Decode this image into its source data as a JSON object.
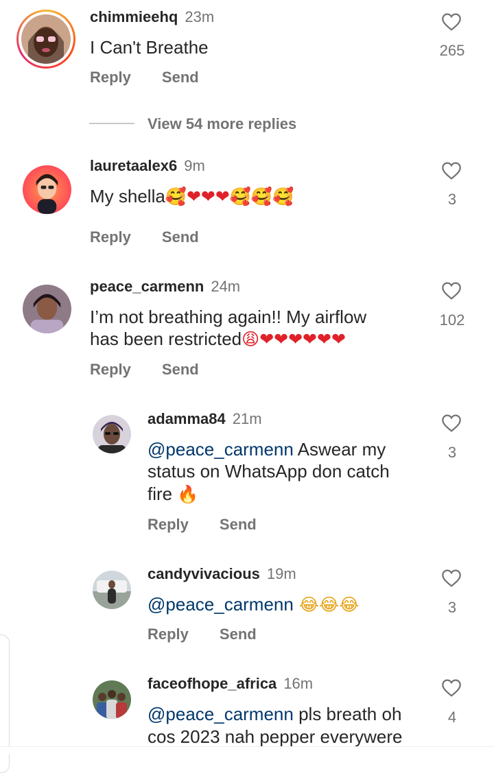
{
  "comments": [
    {
      "username": "chimmieehq",
      "time": "23m",
      "text": "I Can't Breathe",
      "likes": "265",
      "reply_label": "Reply",
      "send_label": "Send"
    },
    {
      "username": "lauretaalex6",
      "time": "9m",
      "text": "My shella",
      "emojis": "🥰❤❤❤🥰🥰🥰",
      "likes": "3",
      "reply_label": "Reply",
      "send_label": "Send"
    },
    {
      "username": "peace_carmenn",
      "time": "24m",
      "text_line1": "I’m not breathing again!! My airflow",
      "text_line2": "has been restricted",
      "emojis": "😩❤❤❤❤❤❤",
      "likes": "102",
      "reply_label": "Reply",
      "send_label": "Send"
    }
  ],
  "view_more": "View 54 more replies",
  "replies": [
    {
      "username": "adamma84",
      "time": "21m",
      "mention": "@peace_carmenn",
      "text_line1": " Aswear my",
      "text_line2": "status on WhatsApp don catch",
      "text_line3": "fire ",
      "emojis": "🔥",
      "likes": "3",
      "reply_label": "Reply",
      "send_label": "Send"
    },
    {
      "username": "candyvivacious",
      "time": "19m",
      "mention": "@peace_carmenn",
      "emojis": " 😂😂😂",
      "likes": "3",
      "reply_label": "Reply",
      "send_label": "Send"
    },
    {
      "username": "faceofhope_africa",
      "time": "16m",
      "mention": "@peace_carmenn",
      "text_line1": " pls breath oh",
      "text_line2": "cos 2023 nah pepper everywere",
      "likes": "4"
    }
  ],
  "icons": {
    "like": "heart-outline-icon"
  },
  "colors": {
    "mention": "#00376b",
    "secondary_text": "#737373",
    "primary_text": "#262626",
    "heart_emoji": "#e0212a"
  }
}
